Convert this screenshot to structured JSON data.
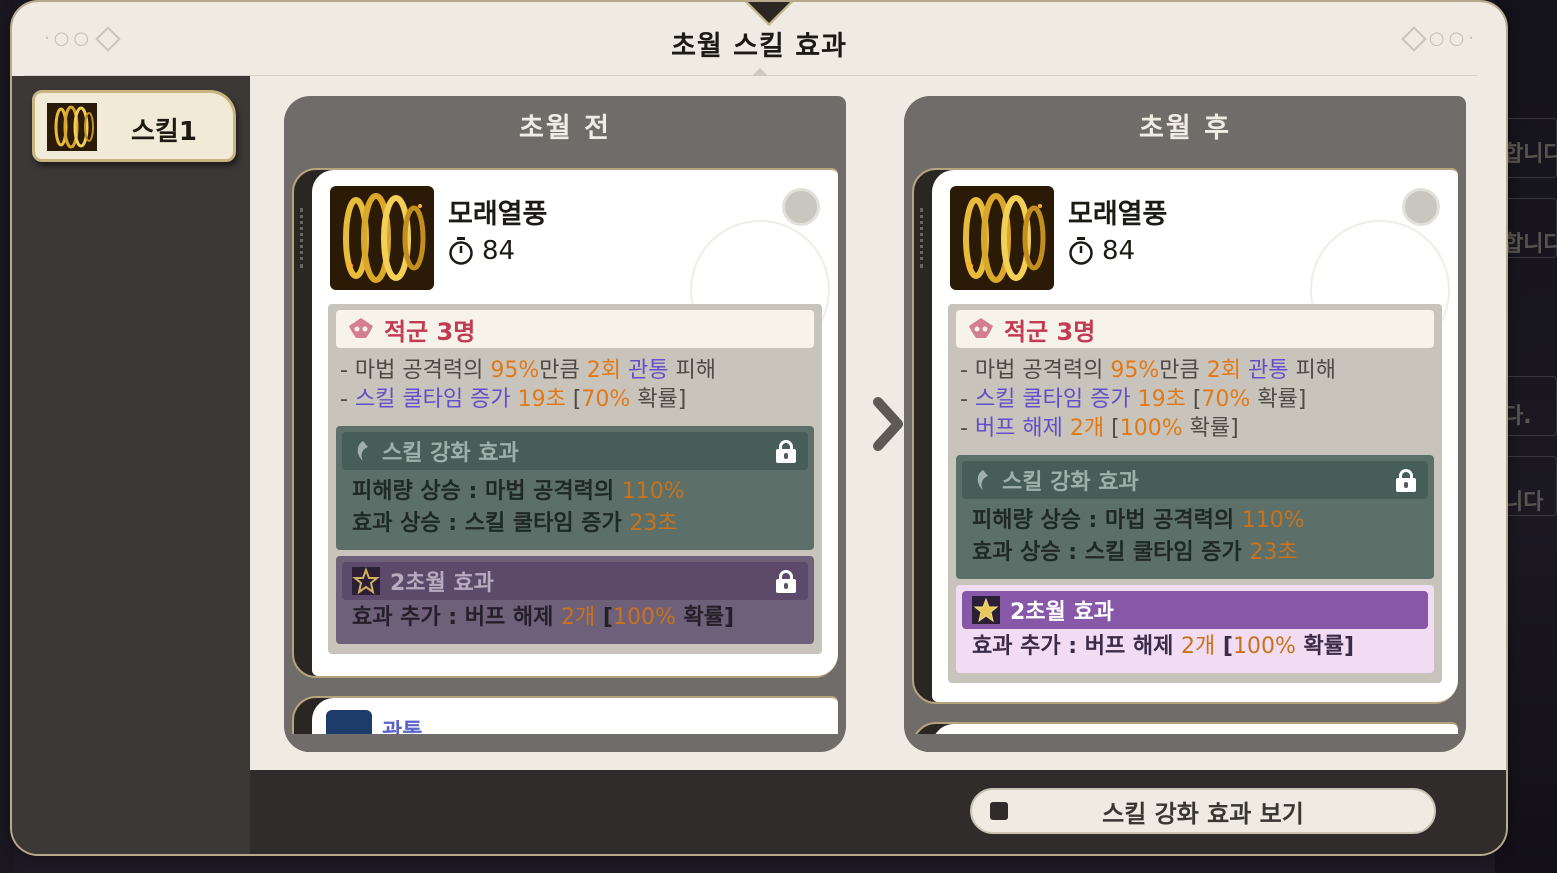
{
  "dialog": {
    "title": "초월 스킬 효과"
  },
  "sidebar": {
    "tabs": [
      {
        "label": "스킬1"
      }
    ]
  },
  "panels": {
    "before": {
      "title": "초월 전",
      "skill": {
        "name": "모래열풍",
        "cooldown": "84"
      },
      "target": "적군 3명",
      "lines": [
        {
          "prefix": "- 마법 공격력의 ",
          "v1": "95%",
          "mid1": "만큼 ",
          "v2": "2회",
          "mid2": " ",
          "v3": "관통",
          "suffix": " 피해"
        },
        {
          "prefix": "- ",
          "v1": "스킬 쿨타임 증가",
          "mid1": " ",
          "v2": "19초",
          "mid2": " [",
          "v3": "70%",
          "suffix": " 확률]"
        }
      ],
      "enhance": {
        "title": "스킬 강화 효과",
        "line1_label": "피해량 상승 : 마법 공격력의 ",
        "line1_value": "110%",
        "line2_label": "효과 상승 : 스킬 쿨타임 증가 ",
        "line2_value": "23초"
      },
      "transcend": {
        "title": "2초월 효과",
        "label": "효과 추가 : 버프 해제 ",
        "value": "2개",
        "bracket_open": " [",
        "chance": "100%",
        "bracket_close": " 확률]"
      },
      "next_skill": {
        "label": "관통"
      }
    },
    "after": {
      "title": "초월 후",
      "skill": {
        "name": "모래열풍",
        "cooldown": "84"
      },
      "target": "적군 3명",
      "lines": [
        {
          "prefix": "- 마법 공격력의 ",
          "v1": "95%",
          "mid1": "만큼 ",
          "v2": "2회",
          "mid2": " ",
          "v3": "관통",
          "suffix": " 피해"
        },
        {
          "prefix": "- ",
          "v1": "스킬 쿨타임 증가",
          "mid1": " ",
          "v2": "19초",
          "mid2": " [",
          "v3": "70%",
          "suffix": " 확률]"
        },
        {
          "prefix": "- ",
          "v1": "버프 해제",
          "mid1": " ",
          "v2": "2개",
          "mid2": " [",
          "v3": "100%",
          "suffix": " 확률]"
        }
      ],
      "enhance": {
        "title": "스킬 강화 효과",
        "line1_label": "피해량 상승 : 마법 공격력의 ",
        "line1_value": "110%",
        "line2_label": "효과 상승 : 스킬 쿨타임 증가 ",
        "line2_value": "23초"
      },
      "transcend": {
        "title": "2초월 효과",
        "label": "효과 추가 : 버프 해제 ",
        "value": "2개",
        "bracket_open": " [",
        "chance": "100%",
        "bracket_close": " 확률]"
      }
    }
  },
  "footer": {
    "toggle_label": "스킬 강화 효과 보기",
    "toggle_checked": false
  },
  "background_text": [
    "합니다",
    "합니다",
    "다.",
    "니다"
  ],
  "icons": {
    "cooldown": "stopwatch-icon",
    "target": "skull-icon",
    "enhance": "enhance-icon",
    "transcend": "transcend-star-icon",
    "lock": "lock-icon",
    "arrow": "chevron-right-icon"
  },
  "colors": {
    "orange": "#e07a18",
    "purple": "#6150c9",
    "red": "#c23b52",
    "enhance_bg": "#5c7069",
    "transcend_active": "#8858a8"
  }
}
